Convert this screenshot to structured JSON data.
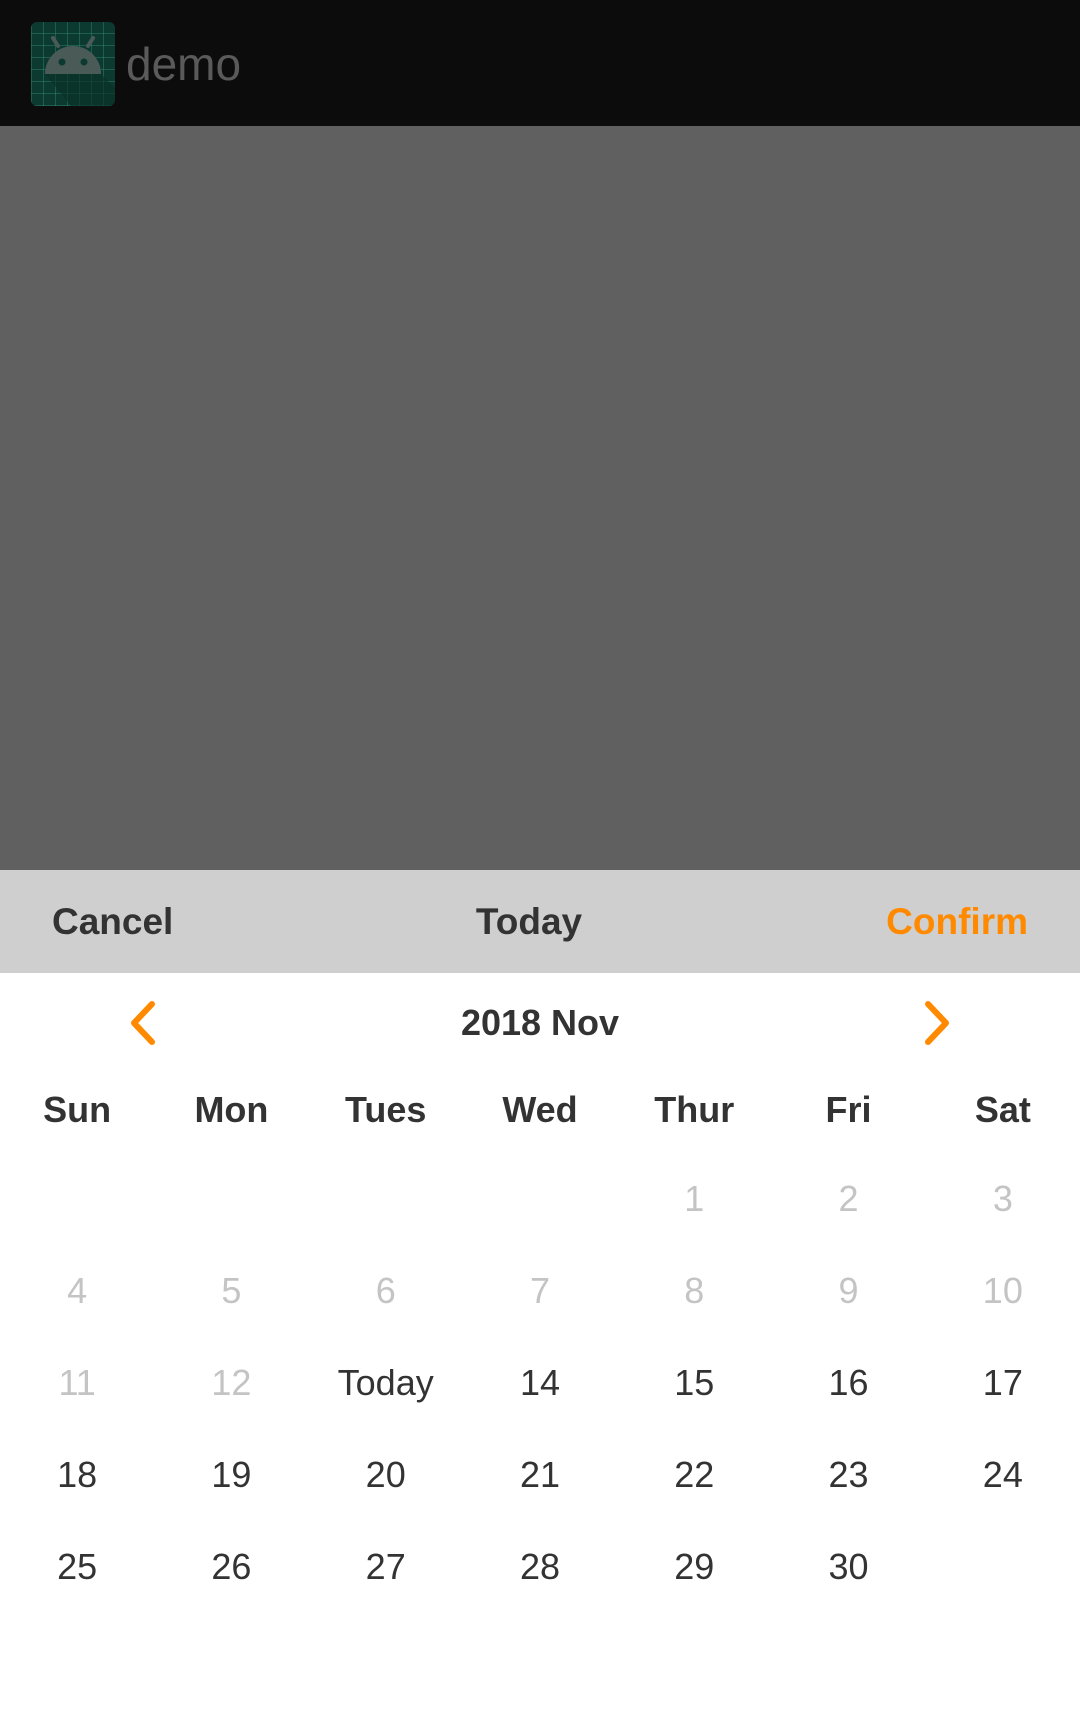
{
  "app": {
    "title": "demo"
  },
  "picker": {
    "cancel_label": "Cancel",
    "today_label": "Today",
    "confirm_label": "Confirm",
    "month_title": "2018 Nov",
    "accent_color": "#ff8a00",
    "weekdays": [
      "Sun",
      "Mon",
      "Tues",
      "Wed",
      "Thur",
      "Fri",
      "Sat"
    ],
    "weeks": [
      [
        {
          "label": "",
          "state": "empty"
        },
        {
          "label": "",
          "state": "empty"
        },
        {
          "label": "",
          "state": "empty"
        },
        {
          "label": "",
          "state": "empty"
        },
        {
          "label": "1",
          "state": "disabled"
        },
        {
          "label": "2",
          "state": "disabled"
        },
        {
          "label": "3",
          "state": "disabled"
        }
      ],
      [
        {
          "label": "4",
          "state": "disabled"
        },
        {
          "label": "5",
          "state": "disabled"
        },
        {
          "label": "6",
          "state": "disabled"
        },
        {
          "label": "7",
          "state": "disabled"
        },
        {
          "label": "8",
          "state": "disabled"
        },
        {
          "label": "9",
          "state": "disabled"
        },
        {
          "label": "10",
          "state": "disabled"
        }
      ],
      [
        {
          "label": "11",
          "state": "disabled"
        },
        {
          "label": "12",
          "state": "disabled"
        },
        {
          "label": "Today",
          "state": "today"
        },
        {
          "label": "14",
          "state": "enabled"
        },
        {
          "label": "15",
          "state": "enabled"
        },
        {
          "label": "16",
          "state": "enabled"
        },
        {
          "label": "17",
          "state": "enabled"
        }
      ],
      [
        {
          "label": "18",
          "state": "enabled"
        },
        {
          "label": "19",
          "state": "enabled"
        },
        {
          "label": "20",
          "state": "enabled"
        },
        {
          "label": "21",
          "state": "enabled"
        },
        {
          "label": "22",
          "state": "enabled"
        },
        {
          "label": "23",
          "state": "enabled"
        },
        {
          "label": "24",
          "state": "enabled"
        }
      ],
      [
        {
          "label": "25",
          "state": "enabled"
        },
        {
          "label": "26",
          "state": "enabled"
        },
        {
          "label": "27",
          "state": "enabled"
        },
        {
          "label": "28",
          "state": "enabled"
        },
        {
          "label": "29",
          "state": "enabled"
        },
        {
          "label": "30",
          "state": "enabled"
        },
        {
          "label": "",
          "state": "empty"
        }
      ]
    ]
  }
}
